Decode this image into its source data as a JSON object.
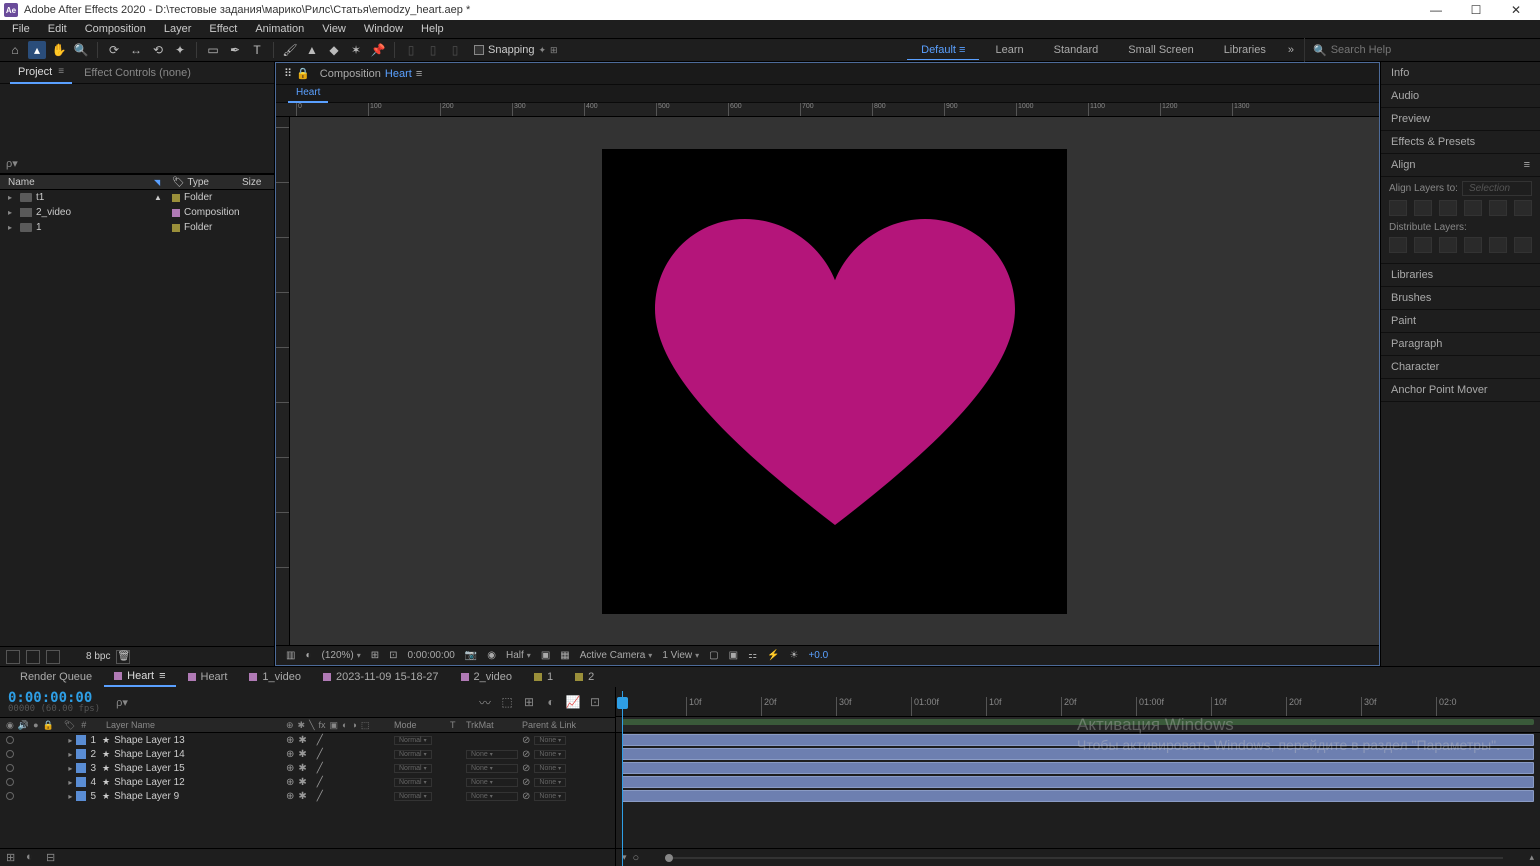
{
  "title": {
    "app": "Adobe After Effects 2020",
    "path": "D:\\тестовые задания\\марико\\Рилс\\Статья\\emodzy_heart.aep *",
    "logo_text": "Ae"
  },
  "menu": [
    "File",
    "Edit",
    "Composition",
    "Layer",
    "Effect",
    "Animation",
    "View",
    "Window",
    "Help"
  ],
  "toolbar": {
    "snapping": "Snapping",
    "search_placeholder": "Search Help"
  },
  "workspaces": [
    "Default",
    "Learn",
    "Standard",
    "Small Screen",
    "Libraries"
  ],
  "project_panel": {
    "tabs": {
      "project": "Project",
      "effect_controls": "Effect Controls (none)"
    },
    "columns": {
      "name": "Name",
      "type": "Type",
      "size": "Size"
    },
    "items": [
      {
        "name": "t1",
        "type": "Folder",
        "kind": "folder"
      },
      {
        "name": "2_video",
        "type": "Composition",
        "kind": "comp"
      },
      {
        "name": "1",
        "type": "Folder",
        "kind": "folder"
      }
    ],
    "footer_bpc": "8 bpc"
  },
  "composition_panel": {
    "label": "Composition",
    "comp_name": "Heart",
    "flow_tab": "Heart",
    "footer": {
      "zoom": "(120%)",
      "time": "0:00:00:00",
      "res": "Half",
      "camera": "Active Camera",
      "view": "1 View",
      "exposure": "+0.0"
    }
  },
  "right_panel": {
    "items_top": [
      "Info",
      "Audio",
      "Preview",
      "Effects & Presets"
    ],
    "align": {
      "title": "Align",
      "layers_to": "Align Layers to:",
      "selection": "Selection",
      "distribute": "Distribute Layers:"
    },
    "items_bottom": [
      "Libraries",
      "Brushes",
      "Paint",
      "Paragraph",
      "Character",
      "Anchor Point Mover"
    ]
  },
  "timeline": {
    "tabs": [
      {
        "label": "Render Queue",
        "active": false,
        "swatch": ""
      },
      {
        "label": "Heart",
        "active": true,
        "swatch": "pur",
        "menu": true
      },
      {
        "label": "Heart",
        "swatch": "pur"
      },
      {
        "label": "1_video",
        "swatch": "pur"
      },
      {
        "label": "2023-11-09 15-18-27",
        "swatch": "pur"
      },
      {
        "label": "2_video",
        "swatch": "pur"
      },
      {
        "label": "1",
        "swatch": "y"
      },
      {
        "label": "2",
        "swatch": "y"
      }
    ],
    "timecode": "0:00:00:00",
    "timecode_sub": "00000 (60.00 fps)",
    "columns": {
      "layer_name": "Layer Name",
      "mode": "Mode",
      "t": "T",
      "trkmat": "TrkMat",
      "parent": "Parent & Link"
    },
    "mode_value": "Normal",
    "trk_value": "None",
    "par_value": "None",
    "layers": [
      {
        "idx": "1",
        "name": "Shape Layer 13"
      },
      {
        "idx": "2",
        "name": "Shape Layer 14"
      },
      {
        "idx": "3",
        "name": "Shape Layer 15"
      },
      {
        "idx": "4",
        "name": "Shape Layer 12"
      },
      {
        "idx": "5",
        "name": "Shape Layer 9"
      }
    ],
    "ruler": [
      "10f",
      "20f",
      "30f",
      "01:00f",
      "10f",
      "20f",
      "01:00f",
      "10f",
      "20f",
      "30f",
      "02:0"
    ]
  },
  "watermark": {
    "title": "Активация Windows",
    "sub": "Чтобы активировать Windows, перейдите в раздел \"Параметры\"."
  }
}
